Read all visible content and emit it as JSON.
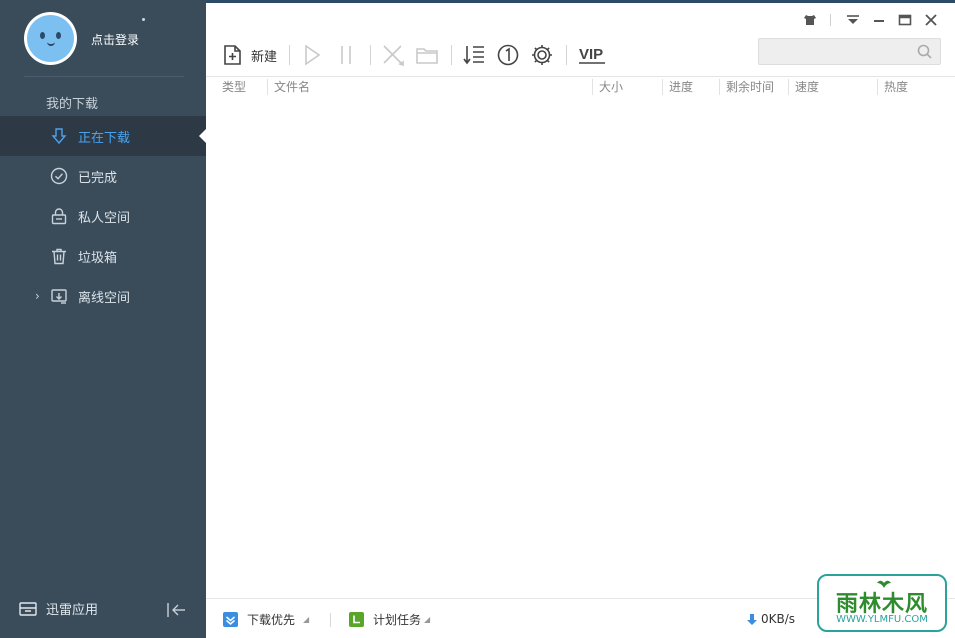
{
  "sidebar": {
    "login_text": "点击登录",
    "section_title": "我的下载",
    "items": [
      {
        "label": "正在下载",
        "icon": "download-arrow-icon",
        "active": true
      },
      {
        "label": "已完成",
        "icon": "check-circle-icon",
        "active": false
      },
      {
        "label": "私人空间",
        "icon": "lock-icon",
        "active": false
      },
      {
        "label": "垃圾箱",
        "icon": "trash-icon",
        "active": false
      },
      {
        "label": "离线空间",
        "icon": "cloud-offline-icon",
        "active": false,
        "expandable": true
      }
    ],
    "bottom_app_label": "迅雷应用",
    "bottom_app_icon": "app-box-icon",
    "collapse_icon": "collapse-left-icon"
  },
  "window_controls": [
    "skin-icon",
    "menu-icon",
    "minimize-icon",
    "maximize-icon",
    "close-icon"
  ],
  "toolbar": {
    "new_label": "新建",
    "vip_label": "VIP",
    "icons": [
      "new-file-icon",
      "play-icon",
      "pause-icon",
      "delete-icon",
      "folder-icon",
      "sort-icon",
      "limit-one-icon",
      "settings-icon",
      "vip-icon"
    ]
  },
  "search": {
    "placeholder": "",
    "icon": "search-icon"
  },
  "table": {
    "columns": [
      "类型",
      "文件名",
      "大小",
      "进度",
      "剩余时间",
      "速度",
      "热度"
    ],
    "rows": []
  },
  "statusbar": {
    "download_priority_label": "下载优先",
    "scheduled_task_label": "计划任务",
    "speed": "0KB/s"
  },
  "watermark": {
    "top": "雨林木风",
    "bottom": "WWW.YLMFU.COM"
  },
  "colors": {
    "sidebar_bg": "#3a4b5a",
    "sidebar_active_bg": "#2d3a46",
    "accent": "#4aa3ef",
    "priority_check": "#3b8de0",
    "schedule_check": "#58a52a"
  }
}
